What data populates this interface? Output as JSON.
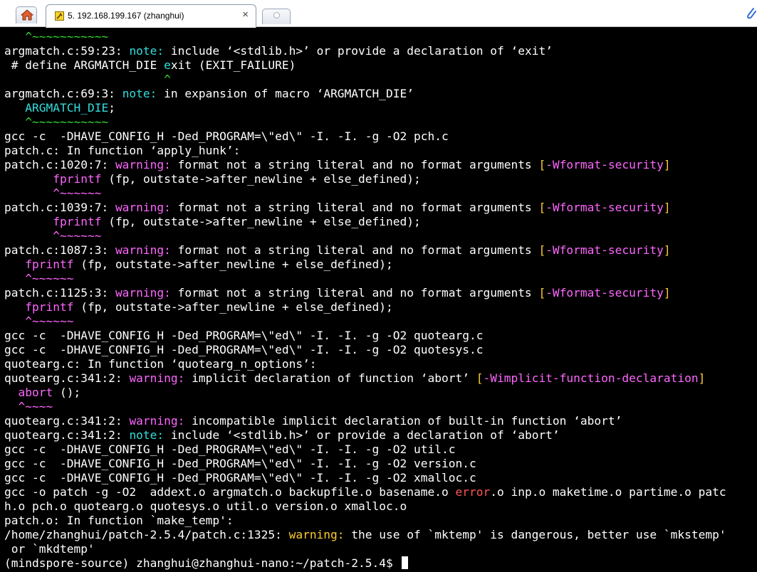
{
  "window": {
    "tab_title": "5. 192.168.199.167 (zhanghui)",
    "close_glyph": "×",
    "home_icon": "home-icon",
    "tab_icon": "ssh-session-icon",
    "new_tab_icon": "new-tab-icon",
    "attach_icon": "paperclip-icon"
  },
  "colors": {
    "background": "#000000",
    "text": "#ffffff",
    "caret": "#33dd33",
    "note": "#33dddd",
    "warning": "#ff66ff",
    "flag": "#ffcc33",
    "error": "#ff5555"
  },
  "terminal": {
    "lines": [
      [
        {
          "t": "   ^~~~~~~~~~~~",
          "c": "g"
        }
      ],
      [
        {
          "t": "argmatch.c:59:23: "
        },
        {
          "t": "note:",
          "c": "c"
        },
        {
          "t": " include ‘<stdlib.h>’ or provide a declaration of ‘exit’"
        }
      ],
      [
        {
          "t": " # define ARGMATCH_DIE "
        },
        {
          "t": "e",
          "c": "c"
        },
        {
          "t": "xit (EXIT_FAILURE)"
        }
      ],
      [
        {
          "t": "                       ^",
          "c": "g"
        }
      ],
      [
        {
          "t": "argmatch.c:69:3: "
        },
        {
          "t": "note:",
          "c": "c"
        },
        {
          "t": " in expansion of macro ‘ARGMATCH_DIE’"
        }
      ],
      [
        {
          "t": "   "
        },
        {
          "t": "ARGMATCH_DIE",
          "c": "c"
        },
        {
          "t": ";"
        }
      ],
      [
        {
          "t": "   ^~~~~~~~~~~~",
          "c": "g"
        }
      ],
      [
        {
          "t": "gcc -c  -DHAVE_CONFIG_H -Ded_PROGRAM=\\\"ed\\\" -I. -I. -g -O2 pch.c"
        }
      ],
      [
        {
          "t": "patch.c: In function ‘apply_hunk’:"
        }
      ],
      [
        {
          "t": "patch.c:1020:7: "
        },
        {
          "t": "warning:",
          "c": "m"
        },
        {
          "t": " format not a string literal and no format arguments "
        },
        {
          "t": "[",
          "c": "y"
        },
        {
          "t": "-Wformat-security",
          "c": "m"
        },
        {
          "t": "]",
          "c": "y"
        }
      ],
      [
        {
          "t": "       "
        },
        {
          "t": "fprintf",
          "c": "m"
        },
        {
          "t": " (fp, outstate->after_newline + else_defined);"
        }
      ],
      [
        {
          "t": "       ^~~~~~~",
          "c": "m"
        }
      ],
      [
        {
          "t": "patch.c:1039:7: "
        },
        {
          "t": "warning:",
          "c": "m"
        },
        {
          "t": " format not a string literal and no format arguments "
        },
        {
          "t": "[",
          "c": "y"
        },
        {
          "t": "-Wformat-security",
          "c": "m"
        },
        {
          "t": "]",
          "c": "y"
        }
      ],
      [
        {
          "t": "       "
        },
        {
          "t": "fprintf",
          "c": "m"
        },
        {
          "t": " (fp, outstate->after_newline + else_defined);"
        }
      ],
      [
        {
          "t": "       ^~~~~~~",
          "c": "m"
        }
      ],
      [
        {
          "t": "patch.c:1087:3: "
        },
        {
          "t": "warning:",
          "c": "m"
        },
        {
          "t": " format not a string literal and no format arguments "
        },
        {
          "t": "[",
          "c": "y"
        },
        {
          "t": "-Wformat-security",
          "c": "m"
        },
        {
          "t": "]",
          "c": "y"
        }
      ],
      [
        {
          "t": "   "
        },
        {
          "t": "fprintf",
          "c": "m"
        },
        {
          "t": " (fp, outstate->after_newline + else_defined);"
        }
      ],
      [
        {
          "t": "   ^~~~~~~",
          "c": "m"
        }
      ],
      [
        {
          "t": "patch.c:1125:3: "
        },
        {
          "t": "warning:",
          "c": "m"
        },
        {
          "t": " format not a string literal and no format arguments "
        },
        {
          "t": "[",
          "c": "y"
        },
        {
          "t": "-Wformat-security",
          "c": "m"
        },
        {
          "t": "]",
          "c": "y"
        }
      ],
      [
        {
          "t": "   "
        },
        {
          "t": "fprintf",
          "c": "m"
        },
        {
          "t": " (fp, outstate->after_newline + else_defined);"
        }
      ],
      [
        {
          "t": "   ^~~~~~~",
          "c": "m"
        }
      ],
      [
        {
          "t": "gcc -c  -DHAVE_CONFIG_H -Ded_PROGRAM=\\\"ed\\\" -I. -I. -g -O2 quotearg.c"
        }
      ],
      [
        {
          "t": "gcc -c  -DHAVE_CONFIG_H -Ded_PROGRAM=\\\"ed\\\" -I. -I. -g -O2 quotesys.c"
        }
      ],
      [
        {
          "t": "quotearg.c: In function ‘quotearg_n_options’:"
        }
      ],
      [
        {
          "t": "quotearg.c:341:2: "
        },
        {
          "t": "warning:",
          "c": "m"
        },
        {
          "t": " implicit declaration of function ‘abort’ "
        },
        {
          "t": "[",
          "c": "y"
        },
        {
          "t": "-Wimplicit-function-declaration",
          "c": "m"
        },
        {
          "t": "]",
          "c": "y"
        }
      ],
      [
        {
          "t": "  "
        },
        {
          "t": "abort",
          "c": "m"
        },
        {
          "t": " ();"
        }
      ],
      [
        {
          "t": "  ^~~~~",
          "c": "m"
        }
      ],
      [
        {
          "t": "quotearg.c:341:2: "
        },
        {
          "t": "warning:",
          "c": "m"
        },
        {
          "t": " incompatible implicit declaration of built-in function ‘abort’"
        }
      ],
      [
        {
          "t": "quotearg.c:341:2: "
        },
        {
          "t": "note:",
          "c": "c"
        },
        {
          "t": " include ‘<stdlib.h>’ or provide a declaration of ‘abort’"
        }
      ],
      [
        {
          "t": "gcc -c  -DHAVE_CONFIG_H -Ded_PROGRAM=\\\"ed\\\" -I. -I. -g -O2 util.c"
        }
      ],
      [
        {
          "t": "gcc -c  -DHAVE_CONFIG_H -Ded_PROGRAM=\\\"ed\\\" -I. -I. -g -O2 version.c"
        }
      ],
      [
        {
          "t": "gcc -c  -DHAVE_CONFIG_H -Ded_PROGRAM=\\\"ed\\\" -I. -I. -g -O2 xmalloc.c"
        }
      ],
      [
        {
          "t": "gcc -o patch -g -O2  addext.o argmatch.o backupfile.o basename.o "
        },
        {
          "t": "error",
          "c": "r"
        },
        {
          "t": ".o inp.o maketime.o partime.o patc"
        }
      ],
      [
        {
          "t": "h.o pch.o quotearg.o quotesys.o util.o version.o xmalloc.o"
        }
      ],
      [
        {
          "t": "patch.o: In function `make_temp':"
        }
      ],
      [
        {
          "t": "/home/zhanghui/patch-2.5.4/patch.c:1325: "
        },
        {
          "t": "warning:",
          "c": "y"
        },
        {
          "t": " the use of `mktemp' is dangerous, better use `mkstemp'"
        }
      ],
      [
        {
          "t": " or `mkdtemp'"
        }
      ],
      [
        {
          "t": "(mindspore-source) zhanghui@zhanghui-nano:~/patch-2.5.4$ "
        }
      ]
    ]
  }
}
